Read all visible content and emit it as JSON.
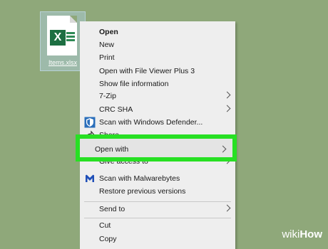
{
  "desktop": {
    "file_name": "Items.xlsx",
    "file_icon_letter": "X",
    "file_icon": "excel-file-icon"
  },
  "context_menu": {
    "items": [
      {
        "label": "Open",
        "bold": true
      },
      {
        "label": "New"
      },
      {
        "label": "Print"
      },
      {
        "label": "Open with File Viewer Plus 3"
      },
      {
        "label": "Show file information"
      },
      {
        "label": "7-Zip",
        "submenu": true
      },
      {
        "label": "CRC SHA",
        "submenu": true
      },
      {
        "label": "Scan with Windows Defender...",
        "icon": "windows-defender-icon"
      },
      {
        "label": "Share",
        "icon": "share-icon"
      },
      {
        "label": "Open with",
        "submenu": true,
        "highlighted": true
      },
      {
        "label": "Give access to",
        "submenu": true
      },
      {
        "label": "Scan with Malwarebytes",
        "icon": "malwarebytes-icon"
      },
      {
        "label": "Restore previous versions"
      },
      {
        "label": "Send to",
        "submenu": true
      },
      {
        "label": "Cut"
      },
      {
        "label": "Copy"
      }
    ]
  },
  "highlight_color": "#27e023",
  "watermark": {
    "brand_a": "wiki",
    "brand_b": "How"
  }
}
